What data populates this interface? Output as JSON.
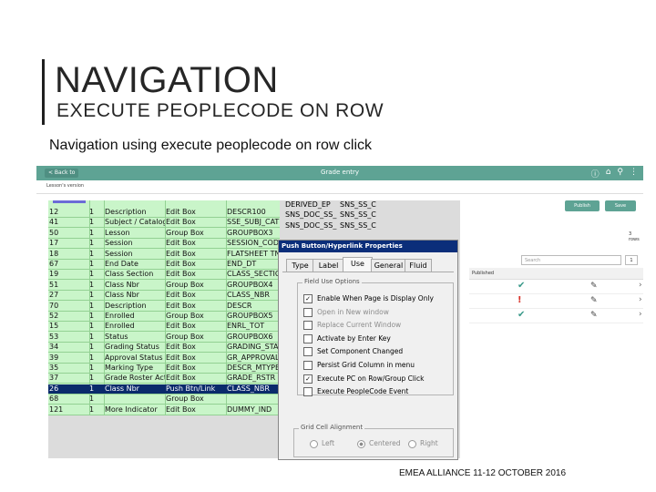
{
  "slide": {
    "title": "NAVIGATION",
    "subtitle": "EXECUTE PEOPLECODE ON ROW",
    "caption": "Navigation using execute peoplecode on row click",
    "footer": "EMEA ALLIANCE 11-12 OCTOBER 2016"
  },
  "app": {
    "back_label": "< Back to",
    "title": "Grade entry",
    "subheader": "Lesson's version",
    "publish_button": "Publish",
    "save_button": "Save",
    "rows_label": "3 rows",
    "search_placeholder": "Search",
    "page_button": "1",
    "published_header": "Published",
    "rows": [
      {
        "status_icon": "check-icon",
        "status_glyph": "✔",
        "status_color": "#3a9a8a"
      },
      {
        "status_icon": "exclamation-icon",
        "status_glyph": "!",
        "status_color": "#d9342b"
      },
      {
        "status_icon": "check-icon",
        "status_glyph": "✔",
        "status_color": "#3a9a8a"
      }
    ],
    "header_color": "#5ea394"
  },
  "grid": {
    "rows": [
      {
        "c1": "12",
        "c2": "1",
        "c3": "Description",
        "c4": "Edit Box",
        "c5": "DESCR100",
        "c6": "DERIVED_EP",
        "c7": "SNS_SS_C"
      },
      {
        "c1": "41",
        "c2": "1",
        "c3": "Subject / Catalog",
        "c4": "Edit Box",
        "c5": "SSE_SUBJ_CATLG",
        "c6": "SNS_DOC_SS_",
        "c7": "SNS_SS_C"
      },
      {
        "c1": "50",
        "c2": "1",
        "c3": "Lesson",
        "c4": "Group Box",
        "c5": "GROUPBOX3",
        "c6": "SNS_DOC_SS_",
        "c7": "SNS_SS_C"
      },
      {
        "c1": "17",
        "c2": "1",
        "c3": "Session",
        "c4": "Edit Box",
        "c5": "SESSION_CODE",
        "c6": "",
        "c7": ""
      },
      {
        "c1": "18",
        "c2": "1",
        "c3": "Session",
        "c4": "Edit Box",
        "c5": "FLATSHEET TN",
        "c6": "",
        "c7": ""
      },
      {
        "c1": "67",
        "c2": "1",
        "c3": "End Date",
        "c4": "Edit Box",
        "c5": "END_DT",
        "c6": "",
        "c7": ""
      },
      {
        "c1": "19",
        "c2": "1",
        "c3": "Class Section",
        "c4": "Edit Box",
        "c5": "CLASS_SECTION",
        "c6": "",
        "c7": ""
      },
      {
        "c1": "51",
        "c2": "1",
        "c3": "Class Nbr",
        "c4": "Group Box",
        "c5": "GROUPBOX4",
        "c6": "",
        "c7": ""
      },
      {
        "c1": "27",
        "c2": "1",
        "c3": "Class Nbr",
        "c4": "Edit Box",
        "c5": "CLASS_NBR",
        "c6": "",
        "c7": ""
      },
      {
        "c1": "70",
        "c2": "1",
        "c3": "Description",
        "c4": "Edit Box",
        "c5": "DESCR",
        "c6": "",
        "c7": ""
      },
      {
        "c1": "52",
        "c2": "1",
        "c3": "Enrolled",
        "c4": "Group Box",
        "c5": "GROUPBOX5",
        "c6": "",
        "c7": ""
      },
      {
        "c1": "15",
        "c2": "1",
        "c3": "Enrolled",
        "c4": "Edit Box",
        "c5": "ENRL_TOT",
        "c6": "",
        "c7": ""
      },
      {
        "c1": "53",
        "c2": "1",
        "c3": "Status",
        "c4": "Group Box",
        "c5": "GROUPBOX6",
        "c6": "",
        "c7": ""
      },
      {
        "c1": "34",
        "c2": "1",
        "c3": "Grading Status",
        "c4": "Edit Box",
        "c5": "GRADING_STATUS",
        "c6": "",
        "c7": ""
      },
      {
        "c1": "39",
        "c2": "1",
        "c3": "Approval Status",
        "c4": "Edit Box",
        "c5": "GR_APPROVAL",
        "c6": "",
        "c7": ""
      },
      {
        "c1": "35",
        "c2": "1",
        "c3": "Marking Type",
        "c4": "Edit Box",
        "c5": "DESCR_MTYPE",
        "c6": "",
        "c7": ""
      },
      {
        "c1": "37",
        "c2": "1",
        "c3": "Grade Roster Action",
        "c4": "Edit Box",
        "c5": "GRADE_RSTR",
        "c6": "",
        "c7": ""
      },
      {
        "c1": "26",
        "c2": "1",
        "c3": "Class Nbr",
        "c4": "Push Btn/Link",
        "c5": "CLASS_NBR",
        "c6": "",
        "c7": ""
      },
      {
        "c1": "68",
        "c2": "1",
        "c3": "",
        "c4": "Group Box",
        "c5": "",
        "c6": "",
        "c7": ""
      },
      {
        "c1": "121",
        "c2": "1",
        "c3": "More Indicator",
        "c4": "Edit Box",
        "c5": "DUMMY_IND",
        "c6": "",
        "c7": ""
      }
    ],
    "selected_index": 17
  },
  "dialog": {
    "title": "Push Button/Hyperlink Properties",
    "tabs": [
      "Type",
      "Label",
      "Use",
      "General",
      "Fluid"
    ],
    "active_tab": "Use",
    "group_label": "Field Use Options",
    "options": [
      {
        "label": "Enable When Page is Display Only",
        "checked": true,
        "enabled": true
      },
      {
        "label": "Open in New window",
        "checked": false,
        "enabled": false
      },
      {
        "label": "Replace Current Window",
        "checked": false,
        "enabled": false
      },
      {
        "label": "Activate by Enter Key",
        "checked": false,
        "enabled": true
      },
      {
        "label": "Set Component Changed",
        "checked": false,
        "enabled": true
      },
      {
        "label": "Persist Grid Column in menu",
        "checked": false,
        "enabled": true
      },
      {
        "label": "Execute PC on Row/Group Click",
        "checked": true,
        "enabled": true
      },
      {
        "label": "Execute PeopleCode Event",
        "checked": false,
        "enabled": true
      }
    ],
    "align_label": "Grid Cell Alignment",
    "align_options": [
      "Left",
      "Centered",
      "Right"
    ],
    "align_selected": "Centered"
  }
}
